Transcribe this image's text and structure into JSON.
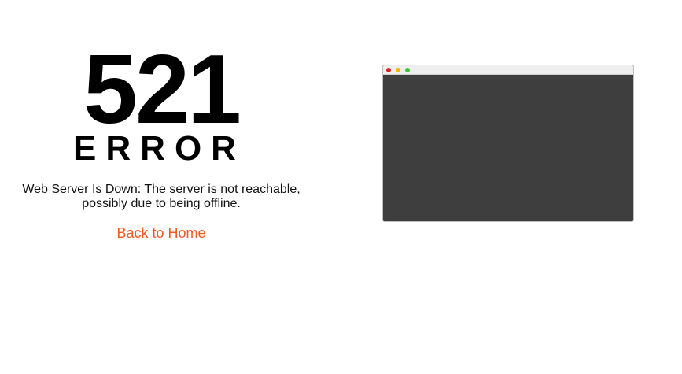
{
  "error": {
    "code": "521",
    "word": "ERROR",
    "message": "Web Server Is Down: The server is not reachable, possibly due to being offline.",
    "link_label": "Back to Home"
  },
  "colors": {
    "link": "#f05a22",
    "browser_body": "#3e3e3e",
    "dot_red": "#e0201c",
    "dot_yellow": "#f2b41a",
    "dot_green": "#3cc23c"
  }
}
